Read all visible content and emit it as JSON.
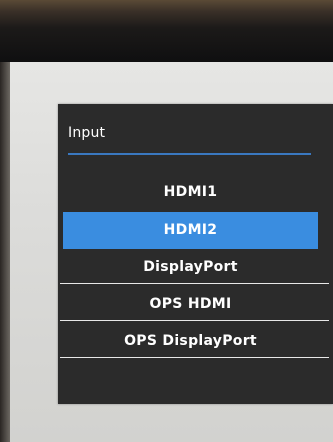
{
  "osd": {
    "title": "Input",
    "items": [
      {
        "label": "HDMI1",
        "selected": false
      },
      {
        "label": "HDMI2",
        "selected": true
      },
      {
        "label": "DisplayPort",
        "selected": false
      },
      {
        "label": "OPS HDMI",
        "selected": false
      },
      {
        "label": "OPS DisplayPort",
        "selected": false
      }
    ]
  },
  "colors": {
    "menu_background": "#2b2b2b",
    "accent": "#3a8de0",
    "header_underline": "#3a78c0",
    "text": "#ffffff"
  }
}
